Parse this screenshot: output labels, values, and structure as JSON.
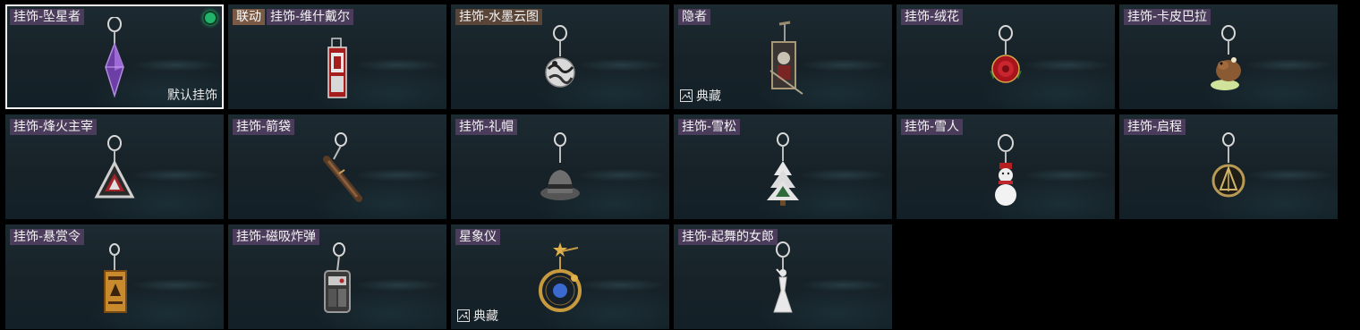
{
  "items": [
    {
      "name": "挂饰-坠星者",
      "selected": true,
      "equipped": true,
      "default_label": "默认挂饰",
      "icon": "purple-crystal-charm-icon"
    },
    {
      "name": "挂饰-维什戴尔",
      "collab_label": "联动",
      "icon": "red-banner-charm-icon"
    },
    {
      "name": "挂饰-水墨云图",
      "icon": "ink-ball-charm-icon"
    },
    {
      "name": "隐者",
      "rarity_label": "典藏",
      "icon": "hermit-card-charm-icon"
    },
    {
      "name": "挂饰-绒花",
      "icon": "red-rose-charm-icon"
    },
    {
      "name": "挂饰-卡皮巴拉",
      "icon": "capybara-charm-icon"
    },
    {
      "name": "挂饰-烽火主宰",
      "icon": "triangle-emblem-charm-icon"
    },
    {
      "name": "挂饰-箭袋",
      "icon": "quiver-charm-icon"
    },
    {
      "name": "挂饰-礼帽",
      "icon": "top-hat-charm-icon"
    },
    {
      "name": "挂饰-雪松",
      "icon": "snowy-pine-charm-icon"
    },
    {
      "name": "挂饰-雪人",
      "icon": "snowman-charm-icon"
    },
    {
      "name": "挂饰-启程",
      "icon": "compass-ring-charm-icon"
    },
    {
      "name": "挂饰-悬赏令",
      "icon": "bounty-scroll-charm-icon"
    },
    {
      "name": "挂饰-磁吸炸弹",
      "icon": "magnet-bomb-charm-icon"
    },
    {
      "name": "星象仪",
      "rarity_label": "典藏",
      "icon": "astrolabe-charm-icon"
    },
    {
      "name": "挂饰-起舞的女郎",
      "icon": "dancing-lady-charm-icon"
    }
  ]
}
